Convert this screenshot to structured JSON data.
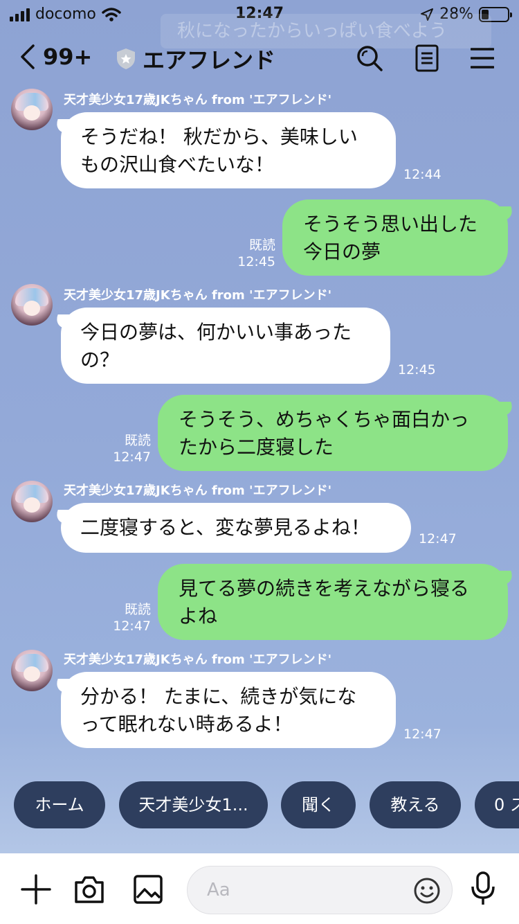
{
  "status_bar": {
    "carrier": "docomo",
    "time": "12:47",
    "battery": "28%",
    "battery_level": 0.28
  },
  "notice_text": "秋になったからいっぱい食べよう",
  "header": {
    "unread_count": "99+",
    "title": "エアフレンド",
    "icons": [
      "back-chevron-icon",
      "shield-star-icon",
      "search-icon",
      "notes-icon",
      "menu-icon"
    ]
  },
  "messages": [
    {
      "direction": "in",
      "sender": "天才美少女17歳JKちゃん from 'エアフレンド'",
      "lines": [
        "そうだね！ 秋だから、美味しい",
        "もの沢山食べたいな！"
      ],
      "time": "12:44"
    },
    {
      "direction": "out",
      "lines": [
        "そうそう思い出した",
        "今日の夢"
      ],
      "read": "既読",
      "time": "12:45"
    },
    {
      "direction": "in",
      "sender": "天才美少女17歳JKちゃん from 'エアフレンド'",
      "lines": [
        "今日の夢は、何かいい事あった",
        "の？"
      ],
      "time": "12:45"
    },
    {
      "direction": "out",
      "lines": [
        "そうそう、めちゃくちゃ面白かっ",
        "たから二度寝した"
      ],
      "read": "既読",
      "time": "12:47"
    },
    {
      "direction": "in",
      "sender": "天才美少女17歳JKちゃん from 'エアフレンド'",
      "lines": [
        "二度寝すると、変な夢見るよね！"
      ],
      "time": "12:47"
    },
    {
      "direction": "out",
      "lines": [
        "見てる夢の続きを考えながら寝る",
        "よね"
      ],
      "read": "既読",
      "time": "12:47"
    },
    {
      "direction": "in",
      "sender": "天才美少女17歳JKちゃん from 'エアフレンド'",
      "lines": [
        "分かる！ たまに、続きが気にな",
        "って眠れない時あるよ！"
      ],
      "time": "12:47"
    }
  ],
  "quick_replies": [
    "ホーム",
    "天才美少女1...",
    "聞く",
    "教える",
    "0 ス"
  ],
  "input": {
    "placeholder": "Aa",
    "icons": [
      "plus-icon",
      "camera-icon",
      "image-icon",
      "emoji-icon",
      "microphone-icon"
    ]
  },
  "colors": {
    "background": "#8fa6d6",
    "bubble_out": "#8de387",
    "bubble_in": "#ffffff",
    "quick_reply": "#2e3e5e"
  }
}
